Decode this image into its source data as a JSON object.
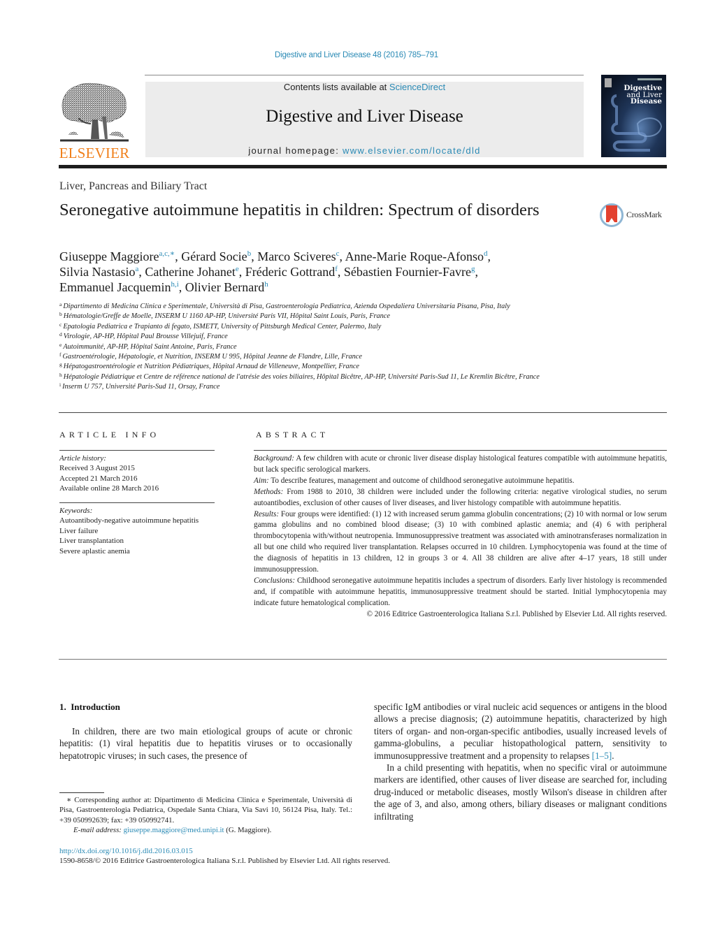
{
  "header": {
    "journal_ref": "Digestive and Liver Disease 48 (2016) 785–791",
    "publisher_logo_text": "ELSEVIER",
    "contents_prefix": "Contents lists available at ",
    "contents_link": "ScienceDirect",
    "journal_title": "Digestive and Liver Disease",
    "homepage_prefix": "journal homepage: ",
    "homepage_link": "www.elsevier.com/locate/dld",
    "cover_title_line1": "Digestive",
    "cover_title_line2": "and Liver",
    "cover_title_line3": "Disease",
    "colors": {
      "link": "#2a8ab5",
      "elsevier_orange": "#f07f1a",
      "masthead_bg": "#ececec"
    }
  },
  "article": {
    "section": "Liver, Pancreas and Biliary Tract",
    "title": "Seronegative autoimmune hepatitis in children: Spectrum of disorders",
    "crossmark_label": "CrossMark",
    "authors": [
      {
        "name": "Giuseppe Maggiore",
        "sup": "a,c,∗",
        "sep": ", "
      },
      {
        "name": "Gérard Socie",
        "sup": "b",
        "sep": ", "
      },
      {
        "name": "Marco Sciveres",
        "sup": "c",
        "sep": ", "
      },
      {
        "name": "Anne-Marie Roque-Afonso",
        "sup": "d",
        "sep": ","
      },
      {
        "name": "Silvia Nastasio",
        "sup": "a",
        "sep": ", "
      },
      {
        "name": "Catherine Johanet",
        "sup": "e",
        "sep": ", "
      },
      {
        "name": "Fréderic Gottrand",
        "sup": "f",
        "sep": ", "
      },
      {
        "name": "Sébastien Fournier-Favre",
        "sup": "g",
        "sep": ","
      },
      {
        "name": "Emmanuel Jacquemin",
        "sup": "h,i",
        "sep": ", "
      },
      {
        "name": "Olivier Bernard",
        "sup": "h",
        "sep": ""
      }
    ],
    "affiliations": [
      {
        "key": "a",
        "text": "Dipartimento di Medicina Clinica e Sperimentale, Università di Pisa, Gastroenterologia Pediatrica, Azienda Ospedaliera Universitaria Pisana, Pisa, Italy"
      },
      {
        "key": "b",
        "text": "Hématologie/Greffe de Moelle, INSERM U 1160 AP-HP, Université Paris VII, Hôpital Saint Louis, Paris, France"
      },
      {
        "key": "c",
        "text": "Epatologia Pediatrica e Trapianto di fegato, ISMETT, University of Pittsburgh Medical Center, Palermo, Italy"
      },
      {
        "key": "d",
        "text": "Virologie, AP-HP, Hôpital Paul Brousse Villejuif, France"
      },
      {
        "key": "e",
        "text": "Autoimmunité, AP-HP, Hôpital Saint Antoine, Paris, France"
      },
      {
        "key": "f",
        "text": "Gastroentérologie, Hépatologie, et Nutrition, INSERM U 995, Hôpital Jeanne de Flandre, Lille, France"
      },
      {
        "key": "g",
        "text": "Hépatogastroentérologie et Nutrition Pédiatriques, Hôpital Arnaud de Villeneuve, Montpellier, France"
      },
      {
        "key": "h",
        "text": "Hépatologie Pédiatrique et Centre de référence national de l'atrésie des voies biliaires, Hôpital Bicêtre, AP-HP, Université Paris-Sud 11, Le Kremlin Bicêtre, France"
      },
      {
        "key": "i",
        "text": "Inserm U 757, Université Paris-Sud 11, Orsay, France"
      }
    ]
  },
  "article_info": {
    "heading": "ARTICLE INFO",
    "history_label": "Article history:",
    "received": "Received 3 August 2015",
    "accepted": "Accepted 21 March 2016",
    "online": "Available online 28 March 2016",
    "keywords_label": "Keywords:",
    "keywords": [
      "Autoantibody-negative autoimmune hepatitis",
      "Liver failure",
      "Liver transplantation",
      "Severe aplastic anemia"
    ]
  },
  "abstract": {
    "heading": "ABSTRACT",
    "sections": [
      {
        "label": "Background:",
        "text": " A few children with acute or chronic liver disease display histological features compatible with autoimmune hepatitis, but lack specific serological markers."
      },
      {
        "label": "Aim:",
        "text": " To describe features, management and outcome of childhood seronegative autoimmune hepatitis."
      },
      {
        "label": "Methods:",
        "text": " From 1988 to 2010, 38 children were included under the following criteria: negative virological studies, no serum autoantibodies, exclusion of other causes of liver diseases, and liver histology compatible with autoimmune hepatitis."
      },
      {
        "label": "Results:",
        "text": " Four groups were identified: (1) 12 with increased serum gamma globulin concentrations; (2) 10 with normal or low serum gamma globulins and no combined blood disease; (3) 10 with combined aplastic anemia; and (4) 6 with peripheral thrombocytopenia with/without neutropenia. Immunosuppressive treatment was associated with aminotransferases normalization in all but one child who required liver transplantation. Relapses occurred in 10 children. Lymphocytopenia was found at the time of the diagnosis of hepatitis in 13 children, 12 in groups 3 or 4. All 38 children are alive after 4–17 years, 18 still under immunosuppression."
      },
      {
        "label": "Conclusions:",
        "text": " Childhood seronegative autoimmune hepatitis includes a spectrum of disorders. Early liver histology is recommended and, if compatible with autoimmune hepatitis, immunosuppressive treatment should be started. Initial lymphocytopenia may indicate future hematological complication."
      }
    ],
    "copyright": "© 2016 Editrice Gastroenterologica Italiana S.r.l. Published by Elsevier Ltd. All rights reserved."
  },
  "body": {
    "intro_heading": "1.  Introduction",
    "intro_p1": "In children, there are two main etiological groups of acute or chronic hepatitis: (1) viral hepatitis due to hepatitis viruses or to occasionally hepatotropic viruses; in such cases, the presence of",
    "col2_p1_a": "specific IgM antibodies or viral nucleic acid sequences or antigens in the blood allows a precise diagnosis; (2) autoimmune hepatitis, characterized by high titers of organ- and non-organ-specific antibodies, usually increased levels of gamma-globulins, a peculiar histopathological pattern, sensitivity to immunosuppressive treatment and a propensity to relapses ",
    "col2_p1_ref": "[1–5]",
    "col2_p1_end": ".",
    "col2_p2": "In a child presenting with hepatitis, when no specific viral or autoimmune markers are identified, other causes of liver disease are searched for, including drug-induced or metabolic diseases, mostly Wilson's disease in children after the age of 3, and also, among others, biliary diseases or malignant conditions infiltrating"
  },
  "footnote": {
    "corresponding": "∗ Corresponding author at: Dipartimento di Medicina Clinica e Sperimentale, Università di Pisa, Gastroenterologia Pediatrica, Ospedale Santa Chiara, Via Savi 10, 56124 Pisa, Italy. Tel.: +39 050992639; fax: +39 050992741.",
    "email_label": "E-mail address:",
    "email": "giuseppe.maggiore@med.unipi.it",
    "email_suffix": " (G. Maggiore)."
  },
  "footer": {
    "doi": "http://dx.doi.org/10.1016/j.dld.2016.03.015",
    "issn_copyright": "1590-8658/© 2016 Editrice Gastroenterologica Italiana S.r.l. Published by Elsevier Ltd. All rights reserved."
  }
}
